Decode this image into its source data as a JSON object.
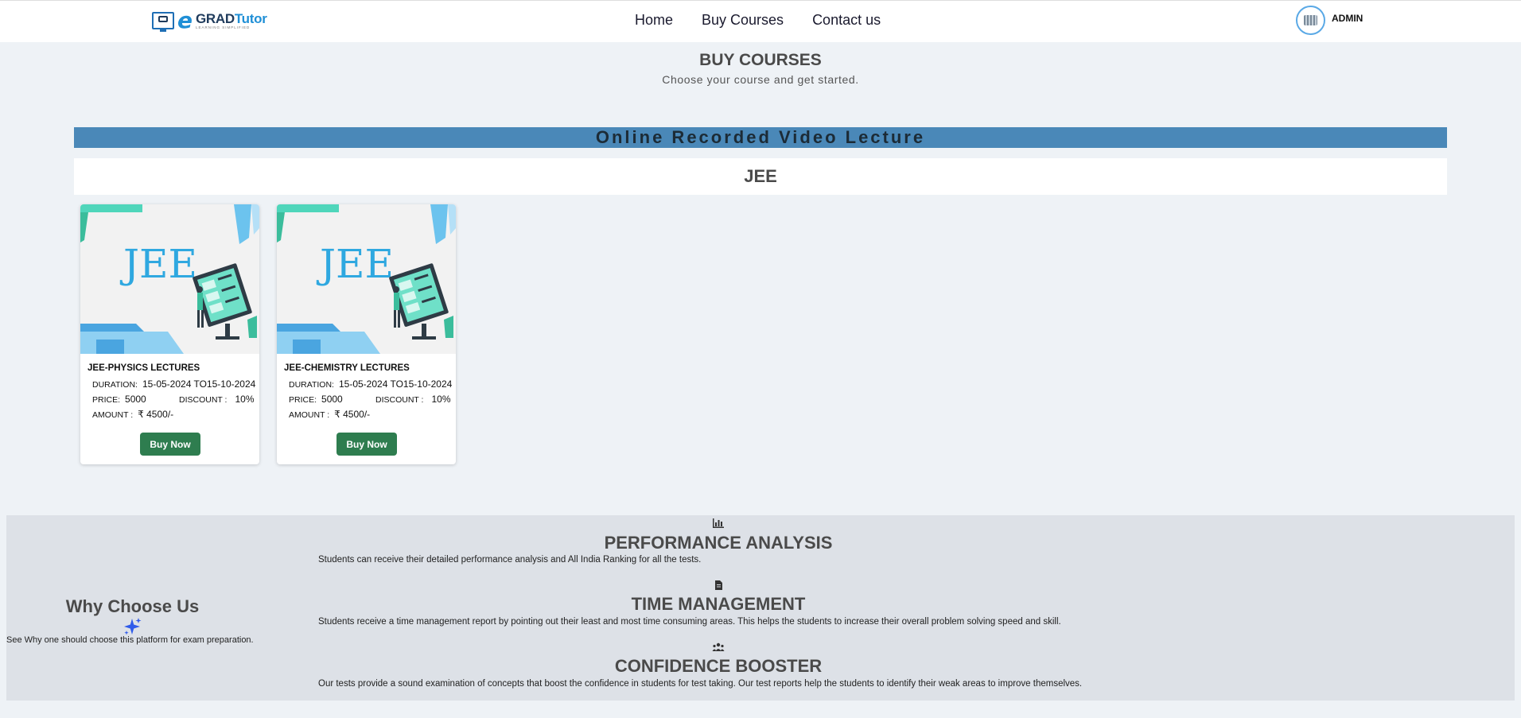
{
  "header": {
    "logo": {
      "brand_e": "e",
      "brand_grad": "GRAD",
      "brand_tutor": "Tutor",
      "tagline": "LEARNING SIMPLIFIED"
    },
    "nav": [
      {
        "label": "Home"
      },
      {
        "label": "Buy Courses"
      },
      {
        "label": "Contact us"
      }
    ],
    "user": {
      "name": "ADMIN"
    }
  },
  "page": {
    "title": "BUY COURSES",
    "subtitle": "Choose your course and get started."
  },
  "section": {
    "band_title": "Online Recorded Video Lecture",
    "category": "JEE"
  },
  "courses": [
    {
      "thumb_text": "JEE",
      "name": "JEE-PHYSICS LECTURES",
      "duration_label": "DURATION:",
      "duration": "15-05-2024 TO15-10-2024",
      "price_label": "PRICE:",
      "price": "5000",
      "discount_label": "DISCOUNT :",
      "discount": "10%",
      "amount_label": "AMOUNT :",
      "amount": "₹  4500/-",
      "button": "Buy Now"
    },
    {
      "thumb_text": "JEE",
      "name": "JEE-CHEMISTRY LECTURES",
      "duration_label": "DURATION:",
      "duration": "15-05-2024 TO15-10-2024",
      "price_label": "PRICE:",
      "price": "5000",
      "discount_label": "DISCOUNT :",
      "discount": "10%",
      "amount_label": "AMOUNT :",
      "amount": "₹  4500/-",
      "button": "Buy Now"
    }
  ],
  "why": {
    "title": "Why Choose Us",
    "subtitle": "See Why one should choose this platform for exam preparation.",
    "features": [
      {
        "icon": "bar-chart-icon",
        "title": "PERFORMANCE ANALYSIS",
        "text": "Students can receive their detailed performance analysis and All India Ranking for all the tests."
      },
      {
        "icon": "document-icon",
        "title": "TIME MANAGEMENT",
        "text": "Students receive a time management report by pointing out their least and most time consuming areas. This helps the students to increase their overall problem solving speed and skill."
      },
      {
        "icon": "people-icon",
        "title": "CONFIDENCE BOOSTER",
        "text": "Our tests provide a sound examination of concepts that boost the confidence in students for test taking. Our test reports help the students to identify their weak areas to improve themselves."
      }
    ]
  },
  "colors": {
    "band": "#4a88b8",
    "buy_button": "#2e7d4f",
    "sparkle": "#2f5bea"
  }
}
